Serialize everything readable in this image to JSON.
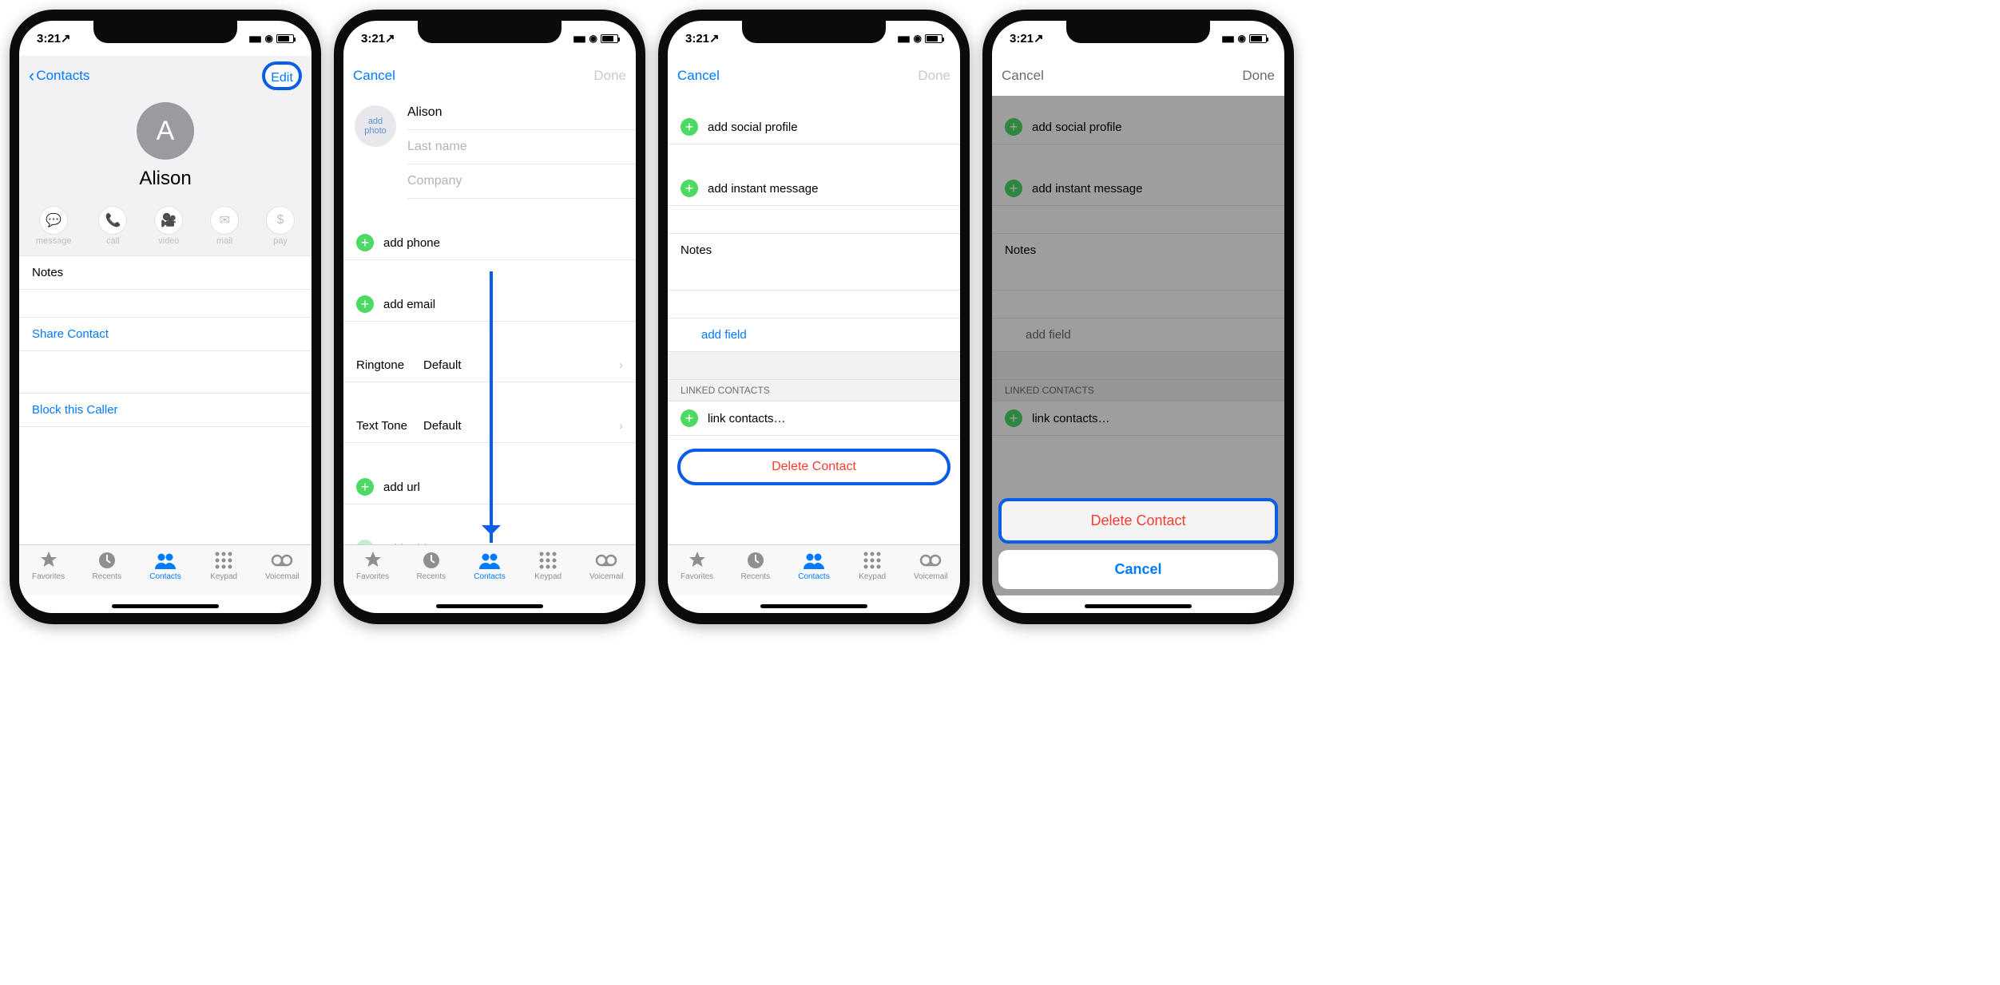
{
  "status": {
    "time": "3:21",
    "location_arrow": "↗"
  },
  "screen1": {
    "nav": {
      "back": "Contacts",
      "edit": "Edit"
    },
    "contact": {
      "initial": "A",
      "name": "Alison"
    },
    "actions": [
      {
        "label": "message",
        "icon": "💬"
      },
      {
        "label": "call",
        "icon": "📞"
      },
      {
        "label": "video",
        "icon": "🎥"
      },
      {
        "label": "mail",
        "icon": "✉"
      },
      {
        "label": "pay",
        "icon": "$"
      }
    ],
    "rows": {
      "notes": "Notes",
      "share": "Share Contact",
      "block": "Block this Caller"
    }
  },
  "screen2": {
    "nav": {
      "cancel": "Cancel",
      "done": "Done"
    },
    "photo": {
      "line1": "add",
      "line2": "photo"
    },
    "fields": {
      "first_name": "Alison",
      "last_name_ph": "Last name",
      "company_ph": "Company"
    },
    "add": {
      "phone": "add phone",
      "email": "add email",
      "url": "add url",
      "address": "add address"
    },
    "ringtone": {
      "label": "Ringtone",
      "value": "Default"
    },
    "text_tone": {
      "label": "Text Tone",
      "value": "Default"
    }
  },
  "screen3": {
    "nav": {
      "cancel": "Cancel",
      "done": "Done"
    },
    "add": {
      "social": "add social profile",
      "im": "add instant message"
    },
    "notes": "Notes",
    "add_field": "add field",
    "linked_header": "LINKED CONTACTS",
    "link_contacts": "link contacts…",
    "delete": "Delete Contact"
  },
  "screen4": {
    "nav": {
      "cancel": "Cancel",
      "done": "Done"
    },
    "sheet": {
      "delete": "Delete Contact",
      "cancel": "Cancel"
    }
  },
  "tabs": [
    {
      "label": "Favorites",
      "icon": "star",
      "active": false
    },
    {
      "label": "Recents",
      "icon": "clock",
      "active": false
    },
    {
      "label": "Contacts",
      "icon": "people",
      "active": true
    },
    {
      "label": "Keypad",
      "icon": "grid",
      "active": false
    },
    {
      "label": "Voicemail",
      "icon": "vm",
      "active": false
    }
  ]
}
